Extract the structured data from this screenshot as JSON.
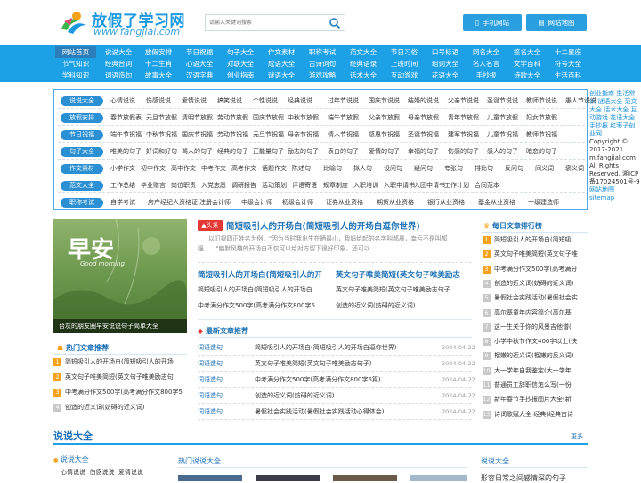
{
  "header": {
    "logo_title": "放假了学习网",
    "logo_url": "www.fangjial.com",
    "search_placeholder": "请输入关键词搜索",
    "mobile_button": "手机网站",
    "sitemap_button": "网站地图"
  },
  "nav": {
    "row1": [
      "网站首页",
      "说说大全",
      "放假安排",
      "节日祝福",
      "句子大全",
      "作文素材",
      "职称考试",
      "范文大全",
      "节日习俗",
      "口号标语",
      "网名大全",
      "签名大全",
      "十二星座"
    ],
    "row2": [
      "节气知识",
      "经典台词",
      "十二生肖",
      "心语大全",
      "对联大全",
      "成语大全",
      "古诗词句",
      "经典语录",
      "上班时间",
      "组词大全",
      "名人名言",
      "文学百科",
      "符号大全"
    ],
    "row3": [
      "学科知识",
      "词语造句",
      "故事大全",
      "汉语字典",
      "创业指南",
      "谜语大全",
      "游戏攻略",
      "话术大全",
      "互动游戏",
      "花语大全",
      "手抄报",
      "诗歌大全",
      "生活百科"
    ]
  },
  "sideinfo": {
    "links1": "创业指南 生活常识 谜语大全 范文大全 话术大全 互动游戏 花语大全 手抄报 红枣子创业网",
    "copyright": "Copyright © 2017-2021 m.fangjial.com All Rights Reserved. 湘ICP备17024501号-9",
    "links2": "网站地图 sitemap"
  },
  "categories": [
    {
      "label": "说说大全",
      "links": [
        "心情说说",
        "伤感说说",
        "爱情说说",
        "搞笑说说",
        "个性说说",
        "经典说说",
        "过年节说说",
        "国庆节说说",
        "结婚的说说",
        "父亲节说说",
        "圣诞节说说",
        "教师节说说",
        "愚人节说说"
      ]
    },
    {
      "label": "放假安排",
      "links": [
        "春节放假表",
        "元旦节放假",
        "清明节放假",
        "劳动节放假",
        "国庆节放假",
        "中秋节放假",
        "端午节放假",
        "父亲节放假",
        "母亲节放假",
        "青年节放假",
        "儿童节放假",
        "妇女节放假"
      ]
    },
    {
      "label": "节日祝福",
      "links": [
        "端午节祝福",
        "中秋节祝福",
        "国庆节祝福",
        "劳动节祝福",
        "元旦节祝福",
        "母亲节祝福",
        "情人节祝福",
        "感恩节祝福",
        "圣诞节祝福",
        "建军节祝福",
        "儿童节祝福",
        "教师节祝福"
      ]
    },
    {
      "label": "句子大全",
      "links": [
        "唯美的句子",
        "好词和好句",
        "骂人的句子",
        "经典的句子",
        "正能量句子",
        "励志的句子",
        "表白的句子",
        "爱情的句子",
        "幸福的句子",
        "伤感的句子",
        "感人的句子",
        "暗恋的句子"
      ]
    },
    {
      "label": "作文素材",
      "links": [
        "小学作文",
        "初中作文",
        "高中作文",
        "中考作文",
        "高考作文",
        "话题作文",
        "陈述句",
        "比喻句",
        "拟人句",
        "设问句",
        "疑问句",
        "夸张句",
        "排比句",
        "反问句",
        "间义词",
        "褒义词"
      ]
    },
    {
      "label": "范文大全",
      "links": [
        "工作总结",
        "毕业赠言",
        "岗位职责",
        "入党志愿",
        "调研报告",
        "活动策划",
        "评语寄语",
        "规章制度",
        "入职培训",
        "入职申请书",
        "入团申请书",
        "工作计划",
        "合同范本"
      ]
    },
    {
      "label": "职称考试",
      "links": [
        "自学考试",
        "房产经纪人资格证",
        "注册会计师",
        "中级会计师",
        "初级会计师",
        "证券从业资格",
        "期货从业资格",
        "银行从业资格",
        "基金从业资格",
        "一级建造师"
      ]
    }
  ],
  "featured": {
    "caption": "台灰的朋友圈早安说说句子简单大全",
    "image_word": "早安",
    "image_sub": "Good morning"
  },
  "headline": {
    "badge": "头条",
    "title": "简短吸引人的开场白(简短吸引人的开场白逗你世界)",
    "summary": "以们视四正姓名为例，\"因为当时我出生在晒最山，我妈给起的名字叫郝晨，幸亏不是叫郝强……\"幽默风趣的开场白不仅可以给对方留下很好印象，还可以…",
    "sub_links": [
      "简短吸引人的开场白(简短吸引人的开",
      "英文句子唯美简短(英文句子唯美励志"
    ],
    "rows": [
      [
        "简短吸引人的开场白(简短吸引人的开场白",
        "英文句子唯美简短(英文句子唯美励志句子"
      ],
      [
        "中考满分作文500字(高考满分作文800字5",
        "创造的近义词(妨碍的近义词)"
      ]
    ]
  },
  "hot": {
    "title": "热门文章推荐",
    "items": [
      "简短吸引人的开场白(简短吸引人的开场",
      "英文句子唯美简短(英文句子唯美励志句",
      "中考满分作文500字(高考满分作文800字5",
      "创造的近义词(妨碍的近义词)"
    ]
  },
  "latest": {
    "title": "最新文章推荐",
    "items": [
      {
        "tag": "词语造句",
        "title": "简短吸引人的开场白(简短吸引人的开场白逗你世界)",
        "date": "2024-04-22"
      },
      {
        "tag": "词语造句",
        "title": "英文句子唯美简短(英文句子唯美励志句子)",
        "date": "2024-04-22"
      },
      {
        "tag": "词语造句",
        "title": "中考满分作文500字(高考满分作文800字5篇)",
        "date": "2024-04-22"
      },
      {
        "tag": "词语造句",
        "title": "创造的近义词(妨碍的近义词)",
        "date": "2024-04-22"
      },
      {
        "tag": "词语造句",
        "title": "暑假社会实践活动(暑假社会实践活动心得体会)",
        "date": "2024-04-22"
      }
    ]
  },
  "ranking": {
    "title": "每日文章排行榜",
    "items": [
      "简短吸引人的开场白(简短吸",
      "英文句子唯美简短(英文句子唯",
      "中考满分作文500字(高考满分",
      "创造的近义词(妨碍的近义词)",
      "暑假社会实践活动(暑假社会实",
      "高尔基童年内容简介(高尔基",
      "这一生关于你的风景吉他谱(",
      "小学中秋节作文400字以上(快",
      "榴嫩的近义词(榴嫩的反义词)",
      "大一学年自我鉴定(大一学年",
      "普通员工辞职信怎么写(一份",
      "新年春节手抄报图片大全(新",
      "诗词歌赋大全 经典(经典古诗"
    ]
  },
  "section2": {
    "title": "说说大全",
    "more": "更多",
    "left_title": "说说大全",
    "left_links": [
      "心情说说",
      "伤感说说",
      "爱情说说"
    ],
    "mid_title": "热门说说大全",
    "right_title": "说说大全",
    "right_first": "形容日常之间感情深的句子"
  }
}
